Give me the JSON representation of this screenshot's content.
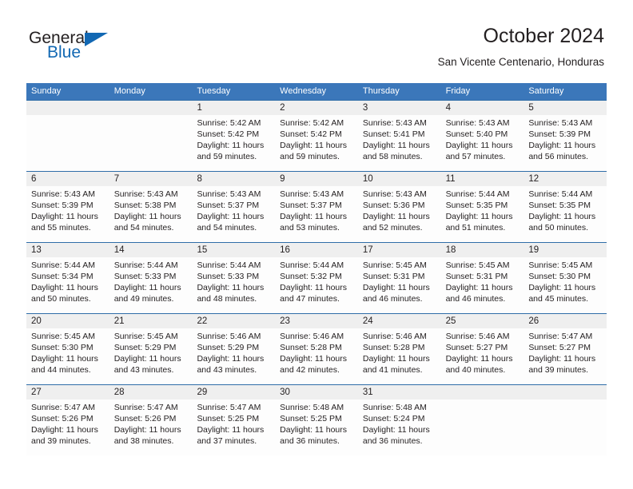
{
  "brand": {
    "word_one": "General",
    "word_two": "Blue",
    "accent_color": "#1268b3",
    "triangle_icon": "triangle-icon"
  },
  "header": {
    "title": "October 2024",
    "subtitle": "San Vicente Centenario, Honduras"
  },
  "calendar": {
    "header_bg": "#3b77ba",
    "header_text_color": "#ffffff",
    "daynum_band_bg": "#efefef",
    "week_divider_color": "#2f6da8",
    "day_names": [
      "Sunday",
      "Monday",
      "Tuesday",
      "Wednesday",
      "Thursday",
      "Friday",
      "Saturday"
    ],
    "weeks": [
      [
        {
          "day": "",
          "lines": [
            "",
            "",
            "",
            ""
          ]
        },
        {
          "day": "",
          "lines": [
            "",
            "",
            "",
            ""
          ]
        },
        {
          "day": "1",
          "lines": [
            "Sunrise: 5:42 AM",
            "Sunset: 5:42 PM",
            "Daylight: 11 hours",
            "and 59 minutes."
          ]
        },
        {
          "day": "2",
          "lines": [
            "Sunrise: 5:42 AM",
            "Sunset: 5:42 PM",
            "Daylight: 11 hours",
            "and 59 minutes."
          ]
        },
        {
          "day": "3",
          "lines": [
            "Sunrise: 5:43 AM",
            "Sunset: 5:41 PM",
            "Daylight: 11 hours",
            "and 58 minutes."
          ]
        },
        {
          "day": "4",
          "lines": [
            "Sunrise: 5:43 AM",
            "Sunset: 5:40 PM",
            "Daylight: 11 hours",
            "and 57 minutes."
          ]
        },
        {
          "day": "5",
          "lines": [
            "Sunrise: 5:43 AM",
            "Sunset: 5:39 PM",
            "Daylight: 11 hours",
            "and 56 minutes."
          ]
        }
      ],
      [
        {
          "day": "6",
          "lines": [
            "Sunrise: 5:43 AM",
            "Sunset: 5:39 PM",
            "Daylight: 11 hours",
            "and 55 minutes."
          ]
        },
        {
          "day": "7",
          "lines": [
            "Sunrise: 5:43 AM",
            "Sunset: 5:38 PM",
            "Daylight: 11 hours",
            "and 54 minutes."
          ]
        },
        {
          "day": "8",
          "lines": [
            "Sunrise: 5:43 AM",
            "Sunset: 5:37 PM",
            "Daylight: 11 hours",
            "and 54 minutes."
          ]
        },
        {
          "day": "9",
          "lines": [
            "Sunrise: 5:43 AM",
            "Sunset: 5:37 PM",
            "Daylight: 11 hours",
            "and 53 minutes."
          ]
        },
        {
          "day": "10",
          "lines": [
            "Sunrise: 5:43 AM",
            "Sunset: 5:36 PM",
            "Daylight: 11 hours",
            "and 52 minutes."
          ]
        },
        {
          "day": "11",
          "lines": [
            "Sunrise: 5:44 AM",
            "Sunset: 5:35 PM",
            "Daylight: 11 hours",
            "and 51 minutes."
          ]
        },
        {
          "day": "12",
          "lines": [
            "Sunrise: 5:44 AM",
            "Sunset: 5:35 PM",
            "Daylight: 11 hours",
            "and 50 minutes."
          ]
        }
      ],
      [
        {
          "day": "13",
          "lines": [
            "Sunrise: 5:44 AM",
            "Sunset: 5:34 PM",
            "Daylight: 11 hours",
            "and 50 minutes."
          ]
        },
        {
          "day": "14",
          "lines": [
            "Sunrise: 5:44 AM",
            "Sunset: 5:33 PM",
            "Daylight: 11 hours",
            "and 49 minutes."
          ]
        },
        {
          "day": "15",
          "lines": [
            "Sunrise: 5:44 AM",
            "Sunset: 5:33 PM",
            "Daylight: 11 hours",
            "and 48 minutes."
          ]
        },
        {
          "day": "16",
          "lines": [
            "Sunrise: 5:44 AM",
            "Sunset: 5:32 PM",
            "Daylight: 11 hours",
            "and 47 minutes."
          ]
        },
        {
          "day": "17",
          "lines": [
            "Sunrise: 5:45 AM",
            "Sunset: 5:31 PM",
            "Daylight: 11 hours",
            "and 46 minutes."
          ]
        },
        {
          "day": "18",
          "lines": [
            "Sunrise: 5:45 AM",
            "Sunset: 5:31 PM",
            "Daylight: 11 hours",
            "and 46 minutes."
          ]
        },
        {
          "day": "19",
          "lines": [
            "Sunrise: 5:45 AM",
            "Sunset: 5:30 PM",
            "Daylight: 11 hours",
            "and 45 minutes."
          ]
        }
      ],
      [
        {
          "day": "20",
          "lines": [
            "Sunrise: 5:45 AM",
            "Sunset: 5:30 PM",
            "Daylight: 11 hours",
            "and 44 minutes."
          ]
        },
        {
          "day": "21",
          "lines": [
            "Sunrise: 5:45 AM",
            "Sunset: 5:29 PM",
            "Daylight: 11 hours",
            "and 43 minutes."
          ]
        },
        {
          "day": "22",
          "lines": [
            "Sunrise: 5:46 AM",
            "Sunset: 5:29 PM",
            "Daylight: 11 hours",
            "and 43 minutes."
          ]
        },
        {
          "day": "23",
          "lines": [
            "Sunrise: 5:46 AM",
            "Sunset: 5:28 PM",
            "Daylight: 11 hours",
            "and 42 minutes."
          ]
        },
        {
          "day": "24",
          "lines": [
            "Sunrise: 5:46 AM",
            "Sunset: 5:28 PM",
            "Daylight: 11 hours",
            "and 41 minutes."
          ]
        },
        {
          "day": "25",
          "lines": [
            "Sunrise: 5:46 AM",
            "Sunset: 5:27 PM",
            "Daylight: 11 hours",
            "and 40 minutes."
          ]
        },
        {
          "day": "26",
          "lines": [
            "Sunrise: 5:47 AM",
            "Sunset: 5:27 PM",
            "Daylight: 11 hours",
            "and 39 minutes."
          ]
        }
      ],
      [
        {
          "day": "27",
          "lines": [
            "Sunrise: 5:47 AM",
            "Sunset: 5:26 PM",
            "Daylight: 11 hours",
            "and 39 minutes."
          ]
        },
        {
          "day": "28",
          "lines": [
            "Sunrise: 5:47 AM",
            "Sunset: 5:26 PM",
            "Daylight: 11 hours",
            "and 38 minutes."
          ]
        },
        {
          "day": "29",
          "lines": [
            "Sunrise: 5:47 AM",
            "Sunset: 5:25 PM",
            "Daylight: 11 hours",
            "and 37 minutes."
          ]
        },
        {
          "day": "30",
          "lines": [
            "Sunrise: 5:48 AM",
            "Sunset: 5:25 PM",
            "Daylight: 11 hours",
            "and 36 minutes."
          ]
        },
        {
          "day": "31",
          "lines": [
            "Sunrise: 5:48 AM",
            "Sunset: 5:24 PM",
            "Daylight: 11 hours",
            "and 36 minutes."
          ]
        },
        {
          "day": "",
          "lines": [
            "",
            "",
            "",
            ""
          ]
        },
        {
          "day": "",
          "lines": [
            "",
            "",
            "",
            ""
          ]
        }
      ]
    ]
  }
}
